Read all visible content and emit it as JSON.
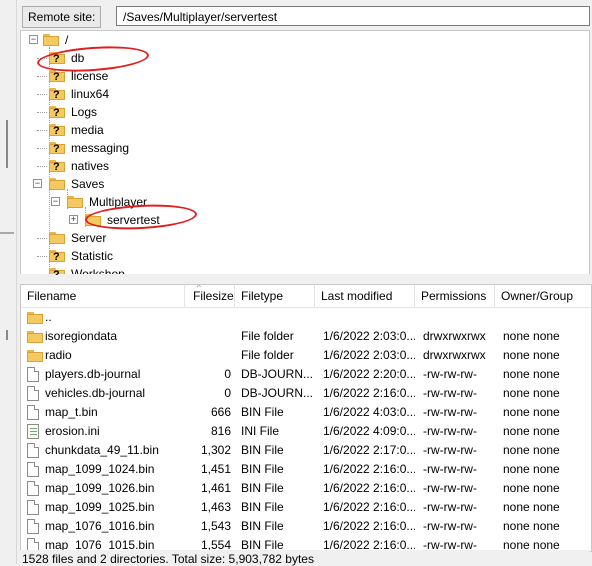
{
  "remote_site": {
    "label": "Remote site:",
    "path": "/Saves/Multiplayer/servertest"
  },
  "tree": {
    "root": "/",
    "items": [
      {
        "label": "db",
        "icon": "unknown-folder-icon"
      },
      {
        "label": "license",
        "icon": "unknown-folder-icon"
      },
      {
        "label": "linux64",
        "icon": "unknown-folder-icon"
      },
      {
        "label": "Logs",
        "icon": "unknown-folder-icon"
      },
      {
        "label": "media",
        "icon": "unknown-folder-icon"
      },
      {
        "label": "messaging",
        "icon": "unknown-folder-icon"
      },
      {
        "label": "natives",
        "icon": "unknown-folder-icon"
      },
      {
        "label": "Saves",
        "icon": "folder-icon"
      },
      {
        "label": "Multiplayer",
        "icon": "folder-icon"
      },
      {
        "label": "servertest",
        "icon": "folder-icon"
      },
      {
        "label": "Server",
        "icon": "folder-icon"
      },
      {
        "label": "Statistic",
        "icon": "unknown-folder-icon"
      },
      {
        "label": "Workshop",
        "icon": "unknown-folder-icon"
      }
    ]
  },
  "columns": [
    "Filename",
    "Filesize",
    "Filetype",
    "Last modified",
    "Permissions",
    "Owner/Group"
  ],
  "files": [
    {
      "name": "..",
      "size": "",
      "type": "",
      "modified": "",
      "perms": "",
      "owner": "",
      "icon": "folder-icon"
    },
    {
      "name": "isoregiondata",
      "size": "",
      "type": "File folder",
      "modified": "1/6/2022 2:03:0...",
      "perms": "drwxrwxrwx",
      "owner": "none none",
      "icon": "folder-icon"
    },
    {
      "name": "radio",
      "size": "",
      "type": "File folder",
      "modified": "1/6/2022 2:03:0...",
      "perms": "drwxrwxrwx",
      "owner": "none none",
      "icon": "folder-icon"
    },
    {
      "name": "players.db-journal",
      "size": "0",
      "type": "DB-JOURN...",
      "modified": "1/6/2022 2:20:0...",
      "perms": "-rw-rw-rw-",
      "owner": "none none",
      "icon": "file-icon"
    },
    {
      "name": "vehicles.db-journal",
      "size": "0",
      "type": "DB-JOURN...",
      "modified": "1/6/2022 2:16:0...",
      "perms": "-rw-rw-rw-",
      "owner": "none none",
      "icon": "file-icon"
    },
    {
      "name": "map_t.bin",
      "size": "666",
      "type": "BIN File",
      "modified": "1/6/2022 4:03:0...",
      "perms": "-rw-rw-rw-",
      "owner": "none none",
      "icon": "file-icon"
    },
    {
      "name": "erosion.ini",
      "size": "816",
      "type": "INI File",
      "modified": "1/6/2022 4:09:0...",
      "perms": "-rw-rw-rw-",
      "owner": "none none",
      "icon": "ini-file-icon"
    },
    {
      "name": "chunkdata_49_11.bin",
      "size": "1,302",
      "type": "BIN File",
      "modified": "1/6/2022 2:17:0...",
      "perms": "-rw-rw-rw-",
      "owner": "none none",
      "icon": "file-icon"
    },
    {
      "name": "map_1099_1024.bin",
      "size": "1,451",
      "type": "BIN File",
      "modified": "1/6/2022 2:16:0...",
      "perms": "-rw-rw-rw-",
      "owner": "none none",
      "icon": "file-icon"
    },
    {
      "name": "map_1099_1026.bin",
      "size": "1,461",
      "type": "BIN File",
      "modified": "1/6/2022 2:16:0...",
      "perms": "-rw-rw-rw-",
      "owner": "none none",
      "icon": "file-icon"
    },
    {
      "name": "map_1099_1025.bin",
      "size": "1,463",
      "type": "BIN File",
      "modified": "1/6/2022 2:16:0...",
      "perms": "-rw-rw-rw-",
      "owner": "none none",
      "icon": "file-icon"
    },
    {
      "name": "map_1076_1016.bin",
      "size": "1,543",
      "type": "BIN File",
      "modified": "1/6/2022 2:16:0...",
      "perms": "-rw-rw-rw-",
      "owner": "none none",
      "icon": "file-icon"
    },
    {
      "name": "map_1076_1015.bin",
      "size": "1,554",
      "type": "BIN File",
      "modified": "1/6/2022 2:16:0...",
      "perms": "-rw-rw-rw-",
      "owner": "none none",
      "icon": "file-icon"
    }
  ],
  "status": "1528 files and 2 directories. Total size: 5,903,782 bytes",
  "colors": {
    "annotation": "#e02020",
    "folder": "#f4c960"
  }
}
